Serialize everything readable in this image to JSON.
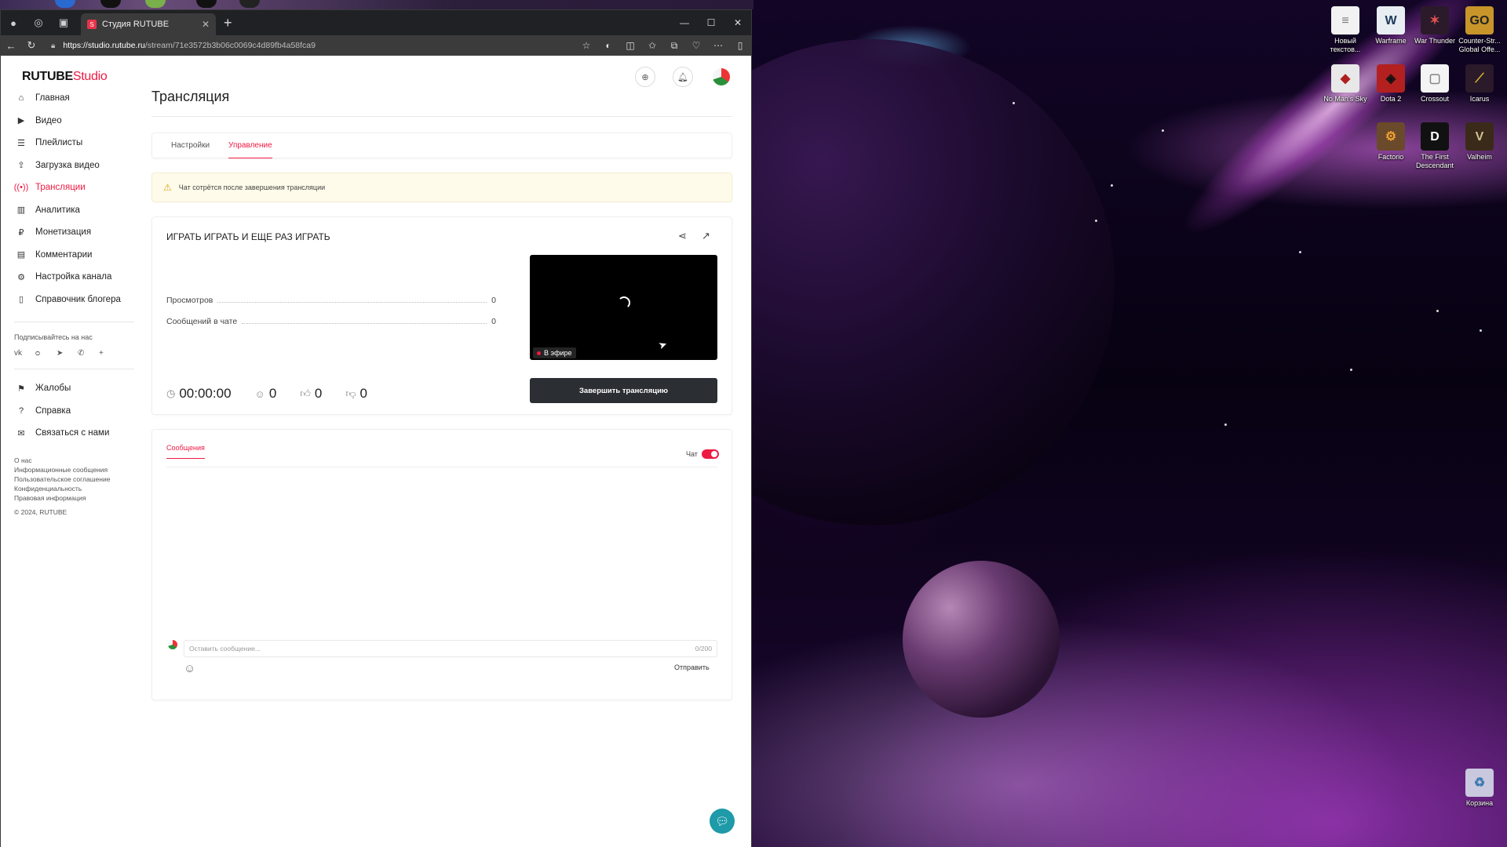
{
  "browser": {
    "tab_title": "Студия RUTUBE",
    "url_host": "https://studio.rutube.ru",
    "url_path": "/stream/71e3572b3b06c0069c4d89fb4a58fca9"
  },
  "app": {
    "logo_main": "RUTUBE",
    "logo_studio": "Studio",
    "brand_color": "#ed1a43"
  },
  "sidebar": {
    "items": [
      {
        "label": "Главная",
        "icon": "home-icon"
      },
      {
        "label": "Видео",
        "icon": "video-icon"
      },
      {
        "label": "Плейлисты",
        "icon": "playlist-icon"
      },
      {
        "label": "Загрузка видео",
        "icon": "upload-icon"
      },
      {
        "label": "Трансляции",
        "icon": "broadcast-icon",
        "active": true
      },
      {
        "label": "Аналитика",
        "icon": "analytics-icon"
      },
      {
        "label": "Монетизация",
        "icon": "monetization-icon"
      },
      {
        "label": "Комментарии",
        "icon": "comments-icon"
      },
      {
        "label": "Настройка канала",
        "icon": "channel-settings-icon"
      },
      {
        "label": "Справочник блогера",
        "icon": "handbook-icon"
      }
    ],
    "subscribe_title": "Подписывайтесь на нас",
    "socials": [
      "vk-icon",
      "ok-icon",
      "telegram-icon",
      "viber-icon",
      "plus-icon"
    ],
    "secondary": [
      {
        "label": "Жалобы",
        "icon": "flag-icon"
      },
      {
        "label": "Справка",
        "icon": "help-icon"
      },
      {
        "label": "Связаться с нами",
        "icon": "mail-icon"
      }
    ],
    "footer": [
      "О нас",
      "Информационные сообщения",
      "Пользовательское соглашение",
      "Конфиденциальность",
      "Правовая информация",
      "© 2024, RUTUBE"
    ]
  },
  "main": {
    "page_title": "Трансляция",
    "tabs": [
      "Настройки",
      "Управление"
    ],
    "active_tab": "Управление",
    "warning": "Чат сотрётся после завершения трансляции",
    "stream": {
      "title": "ИГРАТЬ ИГРАТЬ И ЕЩЕ РАЗ ИГРАТЬ",
      "views_label": "Просмотров",
      "views_value": "0",
      "chat_msgs_label": "Сообщений в чате",
      "chat_msgs_value": "0",
      "timer": "00:00:00",
      "viewers": "0",
      "likes": "0",
      "dislikes": "0",
      "live_badge": "В эфире",
      "end_button": "Завершить трансляцию"
    },
    "chat": {
      "tab": "Сообщения",
      "toggle_label": "Чат",
      "toggle_on": true,
      "input_placeholder": "Оставить сообщение...",
      "counter": "0/200",
      "send": "Отправить"
    }
  },
  "desktop_icons": [
    {
      "label": "Новый текстов...",
      "icon": "text-file-icon"
    },
    {
      "label": "Warframe",
      "icon": "warframe-icon"
    },
    {
      "label": "War Thunder",
      "icon": "war-thunder-icon"
    },
    {
      "label": "Counter-Str... Global Offe...",
      "icon": "csgo-icon"
    },
    {
      "label": "No Man's Sky",
      "icon": "no-mans-sky-icon"
    },
    {
      "label": "Dota 2",
      "icon": "dota2-icon"
    },
    {
      "label": "Crossout",
      "icon": "crossout-icon"
    },
    {
      "label": "Icarus",
      "icon": "icarus-icon"
    },
    {
      "label": "Factorio",
      "icon": "factorio-icon"
    },
    {
      "label": "The First Descendant",
      "icon": "first-descendant-icon"
    },
    {
      "label": "Valheim",
      "icon": "valheim-icon"
    },
    {
      "label": "Корзина",
      "icon": "recycle-bin-icon"
    }
  ]
}
